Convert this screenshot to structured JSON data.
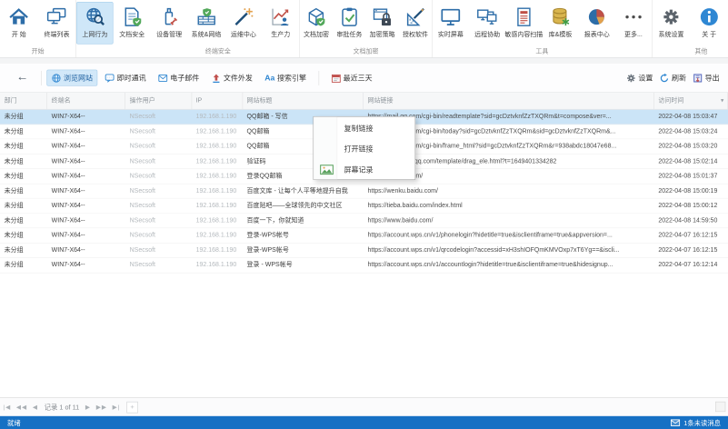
{
  "ribbon": {
    "groups": [
      {
        "label": "开始",
        "tiles": [
          {
            "label": "开 始",
            "icon": "home"
          },
          {
            "label": "终端列表",
            "icon": "terminal-list"
          }
        ]
      },
      {
        "label": "终端安全",
        "tiles": [
          {
            "label": "上网行为",
            "icon": "web-behavior",
            "selected": true
          },
          {
            "label": "文档安全",
            "icon": "document-security"
          },
          {
            "label": "设备管理",
            "icon": "device-management"
          },
          {
            "label": "系统&网络",
            "icon": "system-network"
          },
          {
            "label": "运维中心",
            "icon": "ops-center"
          },
          {
            "label": "生产力",
            "icon": "productivity"
          }
        ]
      },
      {
        "label": "文档加密",
        "tiles": [
          {
            "label": "文档加密",
            "icon": "document-encryption"
          },
          {
            "label": "审批任务",
            "icon": "approval-tasks"
          },
          {
            "label": "加密策略",
            "icon": "encryption-policy"
          },
          {
            "label": "授权软件",
            "icon": "licensed-software"
          }
        ]
      },
      {
        "label": "工具",
        "tiles": [
          {
            "label": "实时屏幕",
            "icon": "realtime-screen"
          },
          {
            "label": "远程协助",
            "icon": "remote-assist"
          },
          {
            "label": "敏感内容扫描",
            "icon": "sensitive-content-scan"
          },
          {
            "label": "库&模板",
            "icon": "library-template"
          },
          {
            "label": "报表中心",
            "icon": "report-center"
          },
          {
            "label": "更多...",
            "icon": "more"
          }
        ]
      },
      {
        "label": "其他",
        "tiles": [
          {
            "label": "系统设置",
            "icon": "system-settings"
          },
          {
            "label": "关 于",
            "icon": "about"
          }
        ]
      }
    ]
  },
  "toolbar": {
    "back_glyph": "←",
    "tabs": [
      {
        "label": "浏览网站",
        "icon": "globe",
        "selected": true
      },
      {
        "label": "即时通讯",
        "icon": "chat"
      },
      {
        "label": "电子邮件",
        "icon": "mail"
      },
      {
        "label": "文件外发",
        "icon": "file-send"
      },
      {
        "label": "搜索引擎",
        "icon": "Aa"
      },
      {
        "label": "最近三天",
        "icon": "calendar"
      }
    ],
    "actions": [
      {
        "label": "设置",
        "icon": "gear-small"
      },
      {
        "label": "刷新",
        "icon": "refresh"
      },
      {
        "label": "导出",
        "icon": "export"
      }
    ]
  },
  "table": {
    "columns": [
      {
        "label": "部门"
      },
      {
        "label": "终端名"
      },
      {
        "label": "操作用户"
      },
      {
        "label": "IP"
      },
      {
        "label": "网站标题"
      },
      {
        "label": "网站链接"
      },
      {
        "label": "访问时间"
      }
    ],
    "rows": [
      {
        "dept": "未分组",
        "term": "WIN7-X64--",
        "user": "NSecsoft",
        "ip": "192.168.1.190",
        "title": "QQ邮箱 - 写信",
        "url": "https://mail.qq.com/cgi-bin/readtemplate?sid=gcDztvknfZzTXQRm&t=compose&ver=...",
        "time": "2022-04-08 15:03:47",
        "selected": true
      },
      {
        "dept": "未分组",
        "term": "WIN7-X64--",
        "user": "NSecsoft",
        "ip": "192.168.1.190",
        "title": "QQ邮箱",
        "url": "https://mail.qq.com/cgi-bin/today?sid=gcDztvknfZzTXQRm&sid=gcDztvknfZzTXQRm&...",
        "time": "2022-04-08 15:03:24"
      },
      {
        "dept": "未分组",
        "term": "WIN7-X64--",
        "user": "NSecsoft",
        "ip": "192.168.1.190",
        "title": "QQ邮箱",
        "url": "https://mail.qq.com/cgi-bin/frame_html?sid=gcDztvknfZzTXQRm&r=938abdc18047e68...",
        "time": "2022-04-08 15:03:20"
      },
      {
        "dept": "未分组",
        "term": "WIN7-X64--",
        "user": "NSecsoft",
        "ip": "192.168.1.190",
        "title": "验证码",
        "url": "https://t.captcha.qq.com/template/drag_ele.html?t=1649401334282",
        "time": "2022-04-08 15:02:14"
      },
      {
        "dept": "未分组",
        "term": "WIN7-X64--",
        "user": "NSecsoft",
        "ip": "192.168.1.190",
        "title": "登录QQ邮箱",
        "url": "https://mail.qq.com/",
        "time": "2022-04-08 15:01:37"
      },
      {
        "dept": "未分组",
        "term": "WIN7-X64--",
        "user": "NSecsoft",
        "ip": "192.168.1.190",
        "title": "百度文库 - 让每个人平等地提升自我",
        "url": "https://wenku.baidu.com/",
        "time": "2022-04-08 15:00:19"
      },
      {
        "dept": "未分组",
        "term": "WIN7-X64--",
        "user": "NSecsoft",
        "ip": "192.168.1.190",
        "title": "百度贴吧——全球领先的中文社区",
        "url": "https://tieba.baidu.com/index.html",
        "time": "2022-04-08 15:00:12"
      },
      {
        "dept": "未分组",
        "term": "WIN7-X64--",
        "user": "NSecsoft",
        "ip": "192.168.1.190",
        "title": "百度一下，你就知道",
        "url": "https://www.baidu.com/",
        "time": "2022-04-08 14:59:50"
      },
      {
        "dept": "未分组",
        "term": "WIN7-X64--",
        "user": "NSecsoft",
        "ip": "192.168.1.190",
        "title": "登录-WPS帐号",
        "url": "https://account.wps.cn/v1/phonelogin?hidetitle=true&isclientiframe=true&appversion=...",
        "time": "2022-04-07 16:12:15"
      },
      {
        "dept": "未分组",
        "term": "WIN7-X64--",
        "user": "NSecsoft",
        "ip": "192.168.1.190",
        "title": "登录-WPS帐号",
        "url": "https://account.wps.cn/v1/qrcodelogin?accessid=xH3shIOFQmKMVOxp7xT6Yg==&iscli...",
        "time": "2022-04-07 16:12:15"
      },
      {
        "dept": "未分组",
        "term": "WIN7-X64--",
        "user": "NSecsoft",
        "ip": "192.168.1.190",
        "title": "登录 - WPS帐号",
        "url": "https://account.wps.cn/v1/accountlogin?hidetitle=true&isclientiframe=true&hidesignup...",
        "time": "2022-04-07 16:12:14"
      }
    ]
  },
  "context_menu": {
    "items": [
      {
        "label": "复制链接"
      },
      {
        "label": "打开链接"
      },
      {
        "label": "屏幕记录",
        "icon": "screen-record"
      }
    ]
  },
  "pager": {
    "record_text": "记录 1 of 11"
  },
  "status_bar": {
    "left": "就绪",
    "right": "1条未读消息"
  }
}
